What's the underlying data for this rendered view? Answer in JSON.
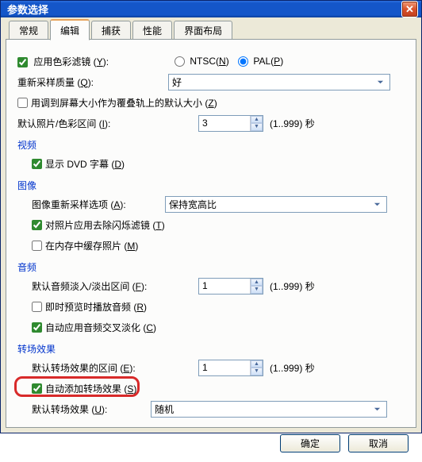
{
  "window": {
    "title": "参数选择"
  },
  "tabs": [
    "常规",
    "编辑",
    "捕获",
    "性能",
    "界面布局"
  ],
  "active_tab_index": 1,
  "edit": {
    "apply_color_filter": {
      "label_pre": "应用色彩滤镜 (",
      "hotkey": "Y",
      "label_post": "):",
      "checked": true
    },
    "ntsc": {
      "label_pre": "NTSC(",
      "hotkey": "N",
      "label_post": ")",
      "checked": false
    },
    "pal": {
      "label_pre": "PAL(",
      "hotkey": "P",
      "label_post": ")",
      "checked": true
    },
    "resample_quality": {
      "label_pre": "重新采样质量 (",
      "hotkey": "Q",
      "label_post": "):",
      "value": "好"
    },
    "fit_overlay_track": {
      "label_pre": "用调到屏幕大小作为覆叠轨上的默认大小 (",
      "hotkey": "Z",
      "label_post": ")",
      "checked": false
    },
    "default_photo_duration": {
      "label_pre": "默认照片/色彩区间 (",
      "hotkey": "I",
      "label_post": "):",
      "value": "3",
      "range": "(1..999) 秒"
    },
    "section_video": "视频",
    "show_dvd_sub": {
      "label_pre": "显示 DVD 字幕 (",
      "hotkey": "D",
      "label_post": ")",
      "checked": true
    },
    "section_image": "图像",
    "image_resample": {
      "label_pre": "图像重新采样选项 (",
      "hotkey": "A",
      "label_post": "):",
      "value": "保持宽高比"
    },
    "deflicker": {
      "label_pre": "对照片应用去除闪烁滤镜 (",
      "hotkey": "T",
      "label_post": ")",
      "checked": true
    },
    "cache_photo": {
      "label_pre": "在内存中缓存照片 (",
      "hotkey": "M",
      "label_post": ")",
      "checked": false
    },
    "section_audio": "音频",
    "audio_fade": {
      "label_pre": "默认音频淡入/淡出区间 (",
      "hotkey": "F",
      "label_post": "):",
      "value": "1",
      "range": "(1..999) 秒"
    },
    "instant_preview": {
      "label_pre": "即时预览时播放音频 (",
      "hotkey": "R",
      "label_post": ")",
      "checked": false
    },
    "auto_crossfade": {
      "label_pre": "自动应用音频交叉淡化 (",
      "hotkey": "C",
      "label_post": ")",
      "checked": true
    },
    "section_transition": "转场效果",
    "trans_duration": {
      "label_pre": "默认转场效果的区间 (",
      "hotkey": "E",
      "label_post": "):",
      "value": "1",
      "range": "(1..999) 秒"
    },
    "auto_add_trans": {
      "label_pre": "自动添加转场效果 (",
      "hotkey": "S",
      "label_post": ")",
      "checked": true
    },
    "default_trans": {
      "label_pre": "默认转场效果 (",
      "hotkey": "U",
      "label_post": "):",
      "value": "随机"
    }
  },
  "buttons": {
    "ok": "确定",
    "cancel": "取消"
  }
}
